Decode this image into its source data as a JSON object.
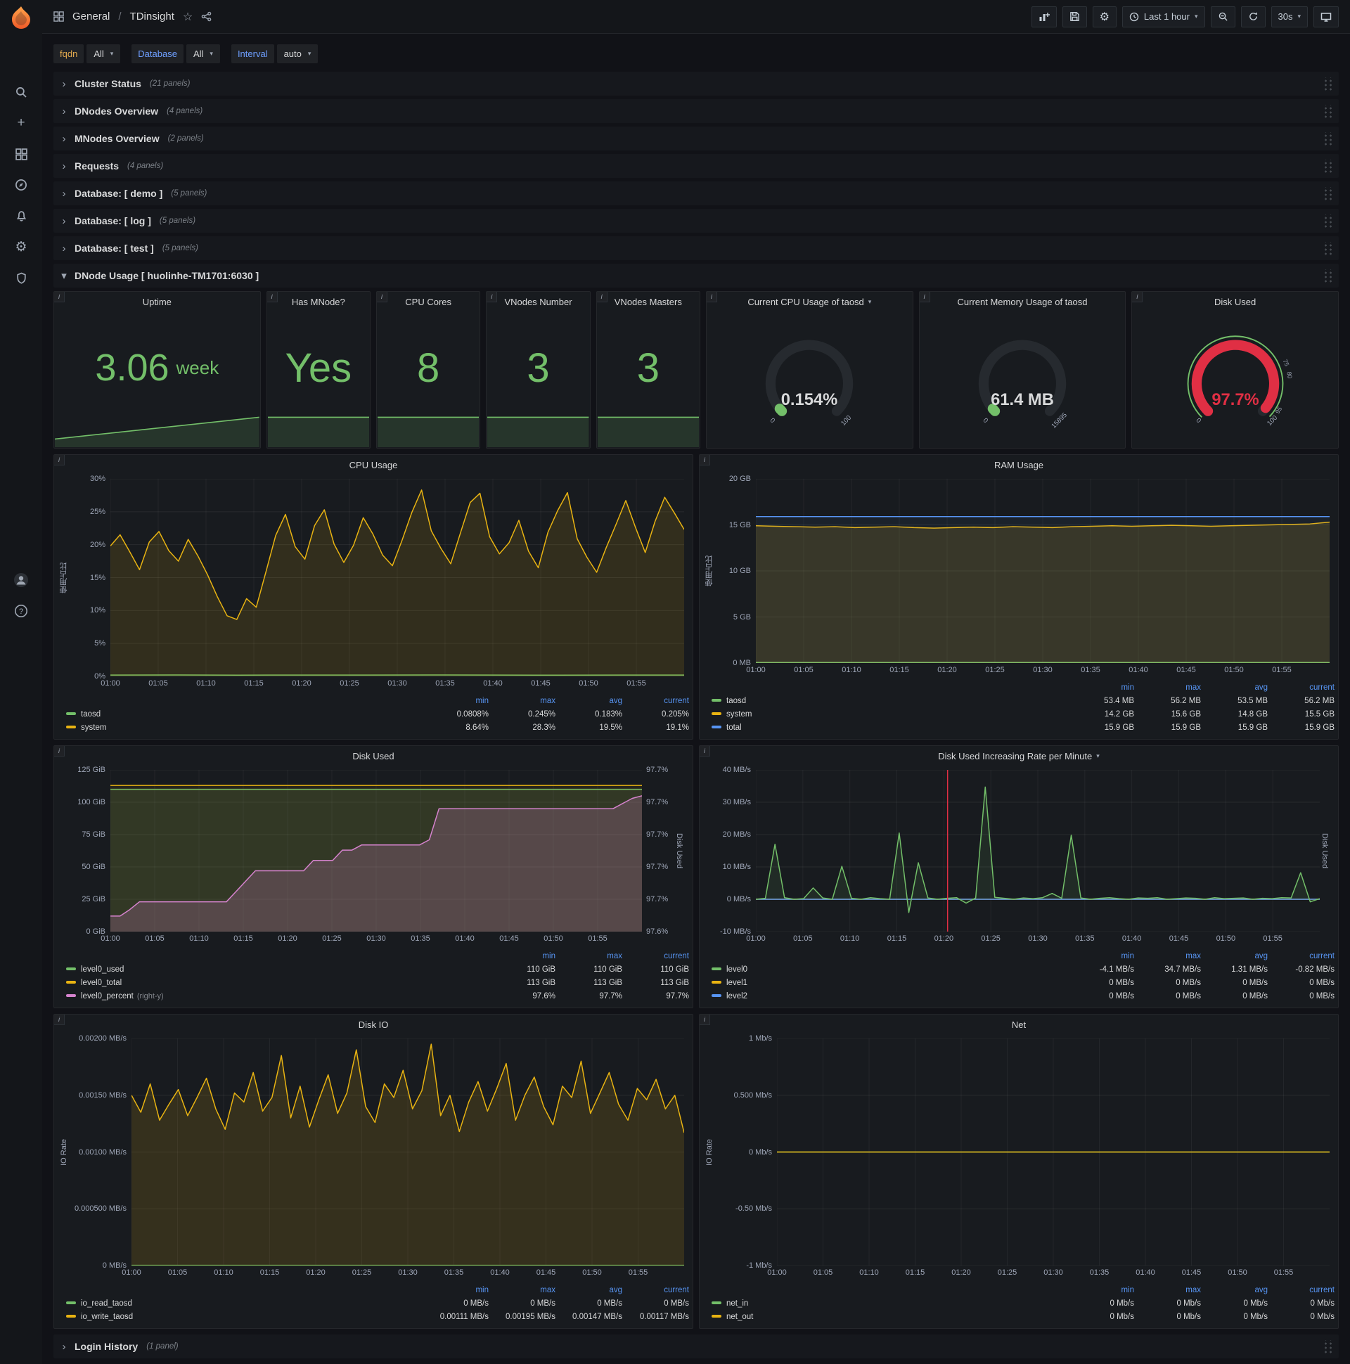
{
  "icons": {
    "gear": "⚙",
    "star": "☆",
    "plus": "+",
    "help": "?",
    "info": "i",
    "chevron_right": "›",
    "chevron_down": "▾",
    "caret_down": "▾"
  },
  "colors": {
    "green": "#73bf69",
    "yellow": "#e8b312",
    "blue": "#5794f2",
    "pink": "#d683ce",
    "red": "#e02f44"
  },
  "navbar": {
    "breadcrumb_section": "General",
    "breadcrumb_sep": "/",
    "breadcrumb_page": "TDinsight",
    "time_range": "Last 1 hour",
    "refresh_interval": "30s"
  },
  "variables": [
    {
      "label": "fqdn",
      "value": "All",
      "label_color": "#e0a84e"
    },
    {
      "label": "Database",
      "value": "All",
      "label_color": "#6e9fff"
    },
    {
      "label": "Interval",
      "value": "auto",
      "label_color": "#6e9fff"
    }
  ],
  "rows_collapsed_top": [
    {
      "title": "Cluster Status",
      "count": "(21 panels)"
    },
    {
      "title": "DNodes Overview",
      "count": "(4 panels)"
    },
    {
      "title": "MNodes Overview",
      "count": "(2 panels)"
    },
    {
      "title": "Requests",
      "count": "(4 panels)"
    },
    {
      "title": "Database: [ demo ]",
      "count": "(5 panels)"
    },
    {
      "title": "Database: [ log ]",
      "count": "(5 panels)"
    },
    {
      "title": "Database: [ test ]",
      "count": "(5 panels)"
    }
  ],
  "expanded_row": {
    "title": "DNode Usage [ huolinhe-TM1701:6030 ]"
  },
  "rows_collapsed_bottom": [
    {
      "title": "Login History",
      "count": "(1 panel)"
    }
  ],
  "stats": [
    {
      "title": "Uptime",
      "value": "3.06",
      "unit": "week",
      "spark": [
        2.9,
        2.92,
        2.94,
        2.96,
        2.98,
        3.0,
        3.02,
        3.04,
        3.06
      ]
    },
    {
      "title": "Has MNode?",
      "value": "Yes",
      "unit": "",
      "spark": [
        1,
        1
      ]
    },
    {
      "title": "CPU Cores",
      "value": "8",
      "unit": "",
      "spark": [
        8,
        8
      ]
    },
    {
      "title": "VNodes Number",
      "value": "3",
      "unit": "",
      "spark": [
        3,
        3
      ]
    },
    {
      "title": "VNodes Masters",
      "value": "3",
      "unit": "",
      "spark": [
        3,
        3
      ]
    }
  ],
  "gauges": [
    {
      "id": "cpu_gauge",
      "title": "Current CPU Usage of taosd",
      "has_dropdown": true,
      "value": "0.154%",
      "fraction": 0.00154,
      "color": "#73bf69",
      "value_color": "#d8d9da",
      "min": "0",
      "max": "100",
      "thresholds": [],
      "outer_ring": false
    },
    {
      "id": "mem_gauge",
      "title": "Current Memory Usage of taosd",
      "has_dropdown": false,
      "value": "61.4 MB",
      "fraction": 0.0039,
      "color": "#73bf69",
      "value_color": "#d8d9da",
      "min": "0",
      "max": "15895",
      "thresholds": [],
      "outer_ring": false
    },
    {
      "id": "disk_gauge",
      "title": "Disk Used",
      "has_dropdown": false,
      "value": "97.7%",
      "fraction": 0.977,
      "color": "#e02f44",
      "value_color": "#e02f44",
      "min": "0",
      "max": "100",
      "thresholds": [
        {
          "label": "75",
          "frac": 0.75
        },
        {
          "label": "80",
          "frac": 0.8
        },
        {
          "label": "95",
          "frac": 0.95
        }
      ],
      "outer_ring": true
    }
  ],
  "charts_common": {
    "x_ticks": [
      "01:00",
      "01:05",
      "01:10",
      "01:15",
      "01:20",
      "01:25",
      "01:30",
      "01:35",
      "01:40",
      "01:45",
      "01:50",
      "01:55"
    ]
  },
  "charts": {
    "cpu": {
      "type": "line",
      "title": "CPU Usage",
      "title_caret": false,
      "y_label": "使用占比",
      "y_ticks": [
        "0%",
        "5%",
        "10%",
        "15%",
        "20%",
        "25%",
        "30%"
      ],
      "ymin": 0,
      "ymax": 30,
      "series": [
        {
          "name": "taosd",
          "color": "#73bf69",
          "fill": 0.1,
          "values": [
            0.2,
            0.21,
            0.19,
            0.2,
            0.2,
            0.21,
            0.2,
            0.19,
            0.2,
            0.2
          ]
        },
        {
          "name": "system",
          "color": "#e8b312",
          "fill": 0.13,
          "values": [
            19.8,
            21.5,
            18.9,
            16.2,
            20.4,
            22.0,
            19.1,
            17.5,
            20.8,
            18.3,
            15.4,
            12.1,
            9.2,
            8.64,
            11.8,
            10.5,
            15.9,
            21.4,
            24.6,
            19.7,
            17.8,
            22.9,
            25.3,
            20.1,
            17.3,
            19.9,
            24.1,
            21.6,
            18.4,
            16.8,
            20.7,
            24.9,
            28.3,
            22.1,
            19.4,
            17.1,
            21.8,
            26.4,
            27.8,
            21.2,
            18.6,
            20.3,
            23.7,
            19.0,
            16.5,
            21.9,
            25.2,
            27.9,
            20.9,
            18.1,
            15.8,
            19.6,
            23.1,
            26.7,
            22.6,
            18.8,
            23.5,
            27.2,
            24.8,
            22.3
          ]
        }
      ],
      "legend": {
        "columns": [
          "min",
          "max",
          "avg",
          "current"
        ],
        "rows": [
          {
            "name": "taosd",
            "color": "#73bf69",
            "values": [
              "0.0808%",
              "0.245%",
              "0.183%",
              "0.205%"
            ]
          },
          {
            "name": "system",
            "color": "#e8b312",
            "values": [
              "8.64%",
              "28.3%",
              "19.5%",
              "19.1%"
            ]
          }
        ]
      }
    },
    "ram": {
      "type": "line",
      "title": "RAM Usage",
      "title_caret": false,
      "y_label": "使用占比",
      "y_ticks": [
        "0 MB",
        "5 GB",
        "10 GB",
        "15 GB",
        "20 GB"
      ],
      "ymin": 0,
      "ymax": 20,
      "series": [
        {
          "name": "taosd",
          "color": "#73bf69",
          "fill": 0.1,
          "values": [
            0.055,
            0.055
          ]
        },
        {
          "name": "system",
          "color": "#e8b312",
          "fill": 0.15,
          "values": [
            14.9,
            14.85,
            14.8,
            14.75,
            14.8,
            14.7,
            14.75,
            14.8,
            14.7,
            14.65,
            14.7,
            14.75,
            14.7,
            14.8,
            14.75,
            14.7,
            14.8,
            14.85,
            14.9,
            14.85,
            14.9,
            14.95,
            14.9,
            14.85,
            14.9,
            14.95,
            15.0,
            15.05,
            15.1,
            15.3
          ]
        },
        {
          "name": "total",
          "color": "#5794f2",
          "fill": 0.06,
          "values": [
            15.9,
            15.9
          ]
        }
      ],
      "legend": {
        "columns": [
          "min",
          "max",
          "avg",
          "current"
        ],
        "rows": [
          {
            "name": "taosd",
            "color": "#73bf69",
            "values": [
              "53.4 MB",
              "56.2 MB",
              "53.5 MB",
              "56.2 MB"
            ]
          },
          {
            "name": "system",
            "color": "#e8b312",
            "values": [
              "14.2 GB",
              "15.6 GB",
              "14.8 GB",
              "15.5 GB"
            ]
          },
          {
            "name": "total",
            "color": "#5794f2",
            "values": [
              "15.9 GB",
              "15.9 GB",
              "15.9 GB",
              "15.9 GB"
            ]
          }
        ]
      }
    },
    "disk_used": {
      "type": "line",
      "title": "Disk Used",
      "title_caret": false,
      "y_label": "",
      "y_ticks": [
        "0 GiB",
        "25 GiB",
        "50 GiB",
        "75 GiB",
        "100 GiB",
        "125 GiB"
      ],
      "ymin": 0,
      "ymax": 125,
      "y2_ticks": [
        "97.6%",
        "97.7%",
        "97.7%",
        "97.7%",
        "97.7%",
        "97.7%"
      ],
      "y2min": 97.595,
      "y2max": 97.72,
      "y2_label": "Disk Used",
      "series": [
        {
          "name": "level0_used",
          "color": "#73bf69",
          "fill": 0.12,
          "values": [
            110,
            110
          ]
        },
        {
          "name": "level0_total",
          "color": "#e8b312",
          "fill": 0.08,
          "values": [
            113,
            113
          ]
        },
        {
          "name": "level0_percent",
          "color": "#d683ce",
          "fill": 0.22,
          "axis": 2,
          "values": [
            97.607,
            97.607,
            97.612,
            97.618,
            97.618,
            97.618,
            97.618,
            97.618,
            97.618,
            97.618,
            97.618,
            97.618,
            97.618,
            97.626,
            97.634,
            97.642,
            97.642,
            97.642,
            97.642,
            97.642,
            97.642,
            97.65,
            97.65,
            97.65,
            97.658,
            97.658,
            97.662,
            97.662,
            97.662,
            97.662,
            97.662,
            97.662,
            97.662,
            97.666,
            97.69,
            97.69,
            97.69,
            97.69,
            97.69,
            97.69,
            97.69,
            97.69,
            97.69,
            97.69,
            97.69,
            97.69,
            97.69,
            97.69,
            97.69,
            97.69,
            97.69,
            97.69,
            97.69,
            97.694,
            97.698,
            97.7
          ]
        }
      ],
      "legend": {
        "columns": [
          "min",
          "max",
          "current"
        ],
        "rows": [
          {
            "name": "level0_used",
            "color": "#73bf69",
            "values": [
              "110 GiB",
              "110 GiB",
              "110 GiB"
            ]
          },
          {
            "name": "level0_total",
            "color": "#e8b312",
            "values": [
              "113 GiB",
              "113 GiB",
              "113 GiB"
            ]
          },
          {
            "name": "level0_percent",
            "suffix": "(right-y)",
            "color": "#d683ce",
            "values": [
              "97.6%",
              "97.7%",
              "97.7%"
            ]
          }
        ]
      }
    },
    "disk_rate": {
      "type": "line",
      "title": "Disk Used Increasing Rate per Minute",
      "title_caret": true,
      "y_label": "",
      "y_ticks": [
        "-10 MB/s",
        "0 MB/s",
        "10 MB/s",
        "20 MB/s",
        "30 MB/s",
        "40 MB/s"
      ],
      "ymin": -10,
      "ymax": 40,
      "y2_label": "Disk Used",
      "annotation_x": 0.34,
      "series": [
        {
          "name": "level1",
          "color": "#e8b312",
          "fill": 0,
          "values": [
            0,
            0
          ]
        },
        {
          "name": "level2",
          "color": "#5794f2",
          "fill": 0,
          "values": [
            0,
            0
          ]
        },
        {
          "name": "level0",
          "color": "#73bf69",
          "fill": 0.1,
          "values": [
            0,
            0.3,
            17,
            0.5,
            0,
            0.2,
            3.5,
            0.4,
            0,
            10.2,
            0.3,
            0,
            0.5,
            0.2,
            0,
            20.5,
            -4.1,
            11.3,
            0.4,
            0,
            0.3,
            0.5,
            -1.2,
            0.4,
            34.7,
            0.6,
            0.3,
            0,
            0.4,
            0.2,
            0.5,
            1.8,
            0.3,
            19.8,
            0.4,
            0,
            0.3,
            0.5,
            0.2,
            0,
            0.4,
            0.3,
            0.5,
            0,
            0.2,
            0.4,
            0.3,
            0,
            0.5,
            0.2,
            0.3,
            0.4,
            0,
            0.3,
            0.2,
            0.5,
            0.4,
            8.2,
            -0.8,
            0.2
          ]
        }
      ],
      "legend": {
        "columns": [
          "min",
          "max",
          "avg",
          "current"
        ],
        "rows": [
          {
            "name": "level0",
            "color": "#73bf69",
            "values": [
              "-4.1 MB/s",
              "34.7 MB/s",
              "1.31 MB/s",
              "-0.82 MB/s"
            ]
          },
          {
            "name": "level1",
            "color": "#e8b312",
            "values": [
              "0 MB/s",
              "0 MB/s",
              "0 MB/s",
              "0 MB/s"
            ]
          },
          {
            "name": "level2",
            "color": "#5794f2",
            "values": [
              "0 MB/s",
              "0 MB/s",
              "0 MB/s",
              "0 MB/s"
            ]
          }
        ]
      }
    },
    "disk_io": {
      "type": "line",
      "title": "Disk IO",
      "title_caret": false,
      "y_label": "IO Rate",
      "y_ticks": [
        "0 MB/s",
        "0.000500 MB/s",
        "0.00100 MB/s",
        "0.00150 MB/s",
        "0.00200 MB/s"
      ],
      "ymin": 0,
      "ymax": 0.002,
      "series": [
        {
          "name": "io_read_taosd",
          "color": "#73bf69",
          "fill": 0.1,
          "values": [
            2e-06,
            2e-06
          ]
        },
        {
          "name": "io_write_taosd",
          "color": "#e8b312",
          "fill": 0.14,
          "values": [
            0.0015,
            0.00135,
            0.0016,
            0.00128,
            0.00142,
            0.00155,
            0.00132,
            0.00148,
            0.00165,
            0.00138,
            0.0012,
            0.00152,
            0.00144,
            0.0017,
            0.00136,
            0.00148,
            0.00185,
            0.0013,
            0.00158,
            0.00122,
            0.00146,
            0.00168,
            0.00134,
            0.00152,
            0.0019,
            0.0014,
            0.00126,
            0.0016,
            0.00148,
            0.00172,
            0.00138,
            0.00154,
            0.00195,
            0.00132,
            0.0015,
            0.00118,
            0.00144,
            0.00162,
            0.00136,
            0.00156,
            0.00178,
            0.00128,
            0.0015,
            0.00166,
            0.0014,
            0.00124,
            0.00158,
            0.00148,
            0.0018,
            0.00134,
            0.00152,
            0.0017,
            0.00142,
            0.00128,
            0.00156,
            0.00146,
            0.00164,
            0.00138,
            0.0015,
            0.00117
          ]
        }
      ],
      "legend": {
        "columns": [
          "min",
          "max",
          "avg",
          "current"
        ],
        "rows": [
          {
            "name": "io_read_taosd",
            "color": "#73bf69",
            "values": [
              "0 MB/s",
              "0 MB/s",
              "0 MB/s",
              "0 MB/s"
            ]
          },
          {
            "name": "io_write_taosd",
            "color": "#e8b312",
            "values": [
              "0.00111 MB/s",
              "0.00195 MB/s",
              "0.00147 MB/s",
              "0.00117 MB/s"
            ]
          }
        ]
      }
    },
    "net": {
      "type": "line",
      "title": "Net",
      "title_caret": false,
      "y_label": "IO Rate",
      "y_ticks": [
        "-1 Mb/s",
        "-0.50 Mb/s",
        "0 Mb/s",
        "0.500 Mb/s",
        "1 Mb/s"
      ],
      "ymin": -1,
      "ymax": 1,
      "series": [
        {
          "name": "net_in",
          "color": "#73bf69",
          "fill": 0,
          "values": [
            0,
            0
          ]
        },
        {
          "name": "net_out",
          "color": "#e8b312",
          "fill": 0,
          "values": [
            0,
            0
          ]
        }
      ],
      "legend": {
        "columns": [
          "min",
          "max",
          "avg",
          "current"
        ],
        "rows": [
          {
            "name": "net_in",
            "color": "#73bf69",
            "values": [
              "0 Mb/s",
              "0 Mb/s",
              "0 Mb/s",
              "0 Mb/s"
            ]
          },
          {
            "name": "net_out",
            "color": "#e8b312",
            "values": [
              "0 Mb/s",
              "0 Mb/s",
              "0 Mb/s",
              "0 Mb/s"
            ]
          }
        ]
      }
    }
  }
}
